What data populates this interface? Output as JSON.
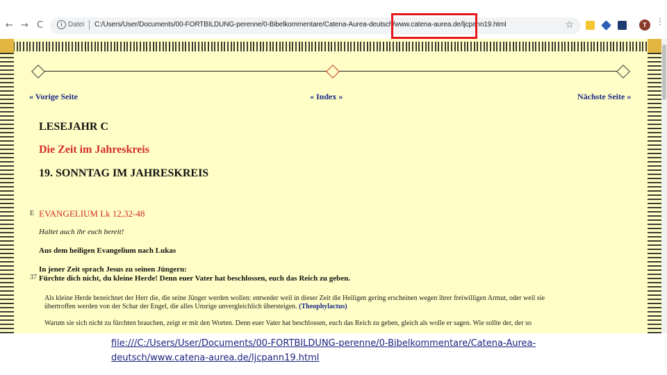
{
  "browser": {
    "back_glyph": "←",
    "forward_glyph": "→",
    "reload_glyph": "C",
    "info_glyph": "i",
    "scheme_label": "Datei",
    "url_text": "C:/Users/User/Documents/00-FORTBILDUNG-perenne/0-Bibelkommentare/Catena-Aurea-deutsch/www.catena-aurea.de/ljcpann19.html",
    "star_glyph": "☆",
    "avatar_letter": "T",
    "menu_glyph": "⋮"
  },
  "page": {
    "nav": {
      "prev": "« Vorige Seite",
      "index": "« Index »",
      "next": "Nächste Seite »"
    },
    "headings": {
      "year": "LESEJAHR C",
      "season": "Die Zeit im Jahreskreis",
      "sunday": "19. SONNTAG IM JAHRESKREIS"
    },
    "gospel_marker": "E",
    "gospel_ref": "EVANGELIUM   Lk 12,32-48",
    "verse_marker": "37",
    "exhort": "Haltet auch ihr euch bereit!",
    "source": "Aus dem heiligen Evangelium nach Lukas",
    "intro": "In jener Zeit sprach Jesus zu seinen Jüngern:",
    "verse": "Fürchte dich nicht, du kleine Herde! Denn euer Vater hat beschlossen, euch das Reich zu geben.",
    "comment1_line1": "Als kleine Herde bezeichnet der Herr die, die seine Jünger werden wollen: entweder weil in dieser Zeit die Heiligen gering erscheinen wegen ihrer freiwilligen Armut, oder weil sie",
    "comment1_line2": "übertroffen werden von der Schar der Engel, die alles Unsrige unvergleichlich übersteigen.",
    "comment1_author": "(Theophylactus)",
    "comment2_line1": "Warum sie sich nicht zu fürchten brauchen, zeigt er mit den Worten. Denn euer Vater hat beschlossen, euch das Reich zu geben, gleich als wolle er sagen. Wie sollte der, der so"
  },
  "caption": "file:///C:/Users/User/Documents/00-FORTBILDUNG-perenne/0-Bibelkommentare/Catena-Aurea-deutsch/www.catena-aurea.de/ljcpann19.html",
  "colors": {
    "page_bg": "#fefec6",
    "link": "#1b2a88",
    "heading_red": "#d42c2c",
    "highlight_box": "#e8141c"
  }
}
